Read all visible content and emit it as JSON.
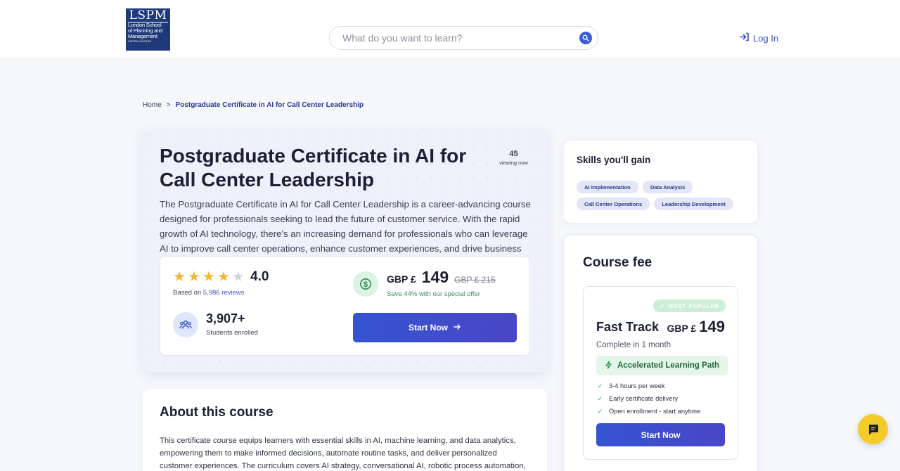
{
  "header": {
    "logo": {
      "mark": "LSPM",
      "lines": [
        "London School",
        "of Planning and",
        "Management"
      ],
      "tagline": "UNITED KINGDOM"
    },
    "search": {
      "placeholder": "What do you want to learn?",
      "value": "",
      "icon": "search-icon"
    },
    "login": {
      "label": "Log In",
      "icon": "login-icon"
    }
  },
  "breadcrumb": {
    "home": "Home",
    "separator": ">",
    "current": "Postgraduate Certificate in AI for Call Center Leadership"
  },
  "hero": {
    "title": "Postgraduate Certificate in AI for Call Center Leadership",
    "viewing_count": "45",
    "viewing_label": "viewing now",
    "description": "The Postgraduate Certificate in AI for Call Center Leadership is a career-advancing course designed for professionals seeking to lead the future of customer service. With the rapid growth of AI technology, there's an increasing demand for professionals who can leverage AI to improve call center operations, enhance customer experiences, and drive business growth.",
    "rating": {
      "value": "4.0",
      "stars_filled": 4,
      "stars_total": 5,
      "based_on_prefix": "Based on",
      "reviews_link": "5,986 reviews"
    },
    "students": {
      "count": "3,907+",
      "label": "Students enrolled",
      "icon": "students-icon"
    },
    "price": {
      "currency": "GBP £",
      "value": "149",
      "old_price": "GBP £ 215",
      "savings": "Save 44% with our special offer",
      "icon": "dollar-icon"
    },
    "cta": {
      "label": "Start Now",
      "icon": "arrow-right-icon"
    }
  },
  "about": {
    "title": "About this course",
    "text": "This certificate course equips learners with essential skills in AI, machine learning, and data analytics, empowering them to make informed decisions, automate routine tasks, and deliver personalized customer experiences. The curriculum covers AI strategy, conversational AI, robotic process automation,"
  },
  "skills": {
    "title": "Skills you'll gain",
    "items": [
      "AI Implementation",
      "Data Analysis",
      "Call Center Operations",
      "Leadership Development"
    ]
  },
  "course_fee": {
    "title": "Course fee",
    "plan": {
      "badge": "MOST POPULAR",
      "name": "Fast Track",
      "currency": "GBP £",
      "price": "149",
      "duration": "Complete in 1 month",
      "path_label": "Accelerated Learning Path",
      "features": [
        "3-4 hours per week",
        "Early certificate delivery",
        "Open enrollment - start anytime"
      ],
      "cta": "Start Now"
    }
  },
  "chat": {
    "icon": "chat-icon"
  },
  "colors": {
    "brand_navy": "#1f3a7a",
    "accent_blue": "#3554d1",
    "link_blue": "#3a55c5",
    "star_gold": "#f2b731",
    "success_green": "#3c9a5b",
    "chat_yellow": "#f3cc2c"
  }
}
